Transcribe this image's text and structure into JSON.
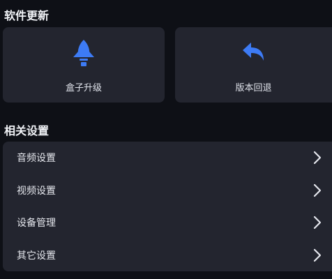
{
  "software_update": {
    "title": "软件更新",
    "cards": [
      {
        "label": "盒子升级",
        "icon": "rocket-icon"
      },
      {
        "label": "版本回退",
        "icon": "undo-arrow-icon"
      }
    ]
  },
  "related_settings": {
    "title": "相关设置",
    "items": [
      {
        "label": "音频设置"
      },
      {
        "label": "视频设置"
      },
      {
        "label": "设备管理"
      },
      {
        "label": "其它设置"
      }
    ]
  },
  "colors": {
    "accent": "#3d7bf5",
    "card_bg": "#23252f",
    "page_bg": "#0e1016"
  }
}
